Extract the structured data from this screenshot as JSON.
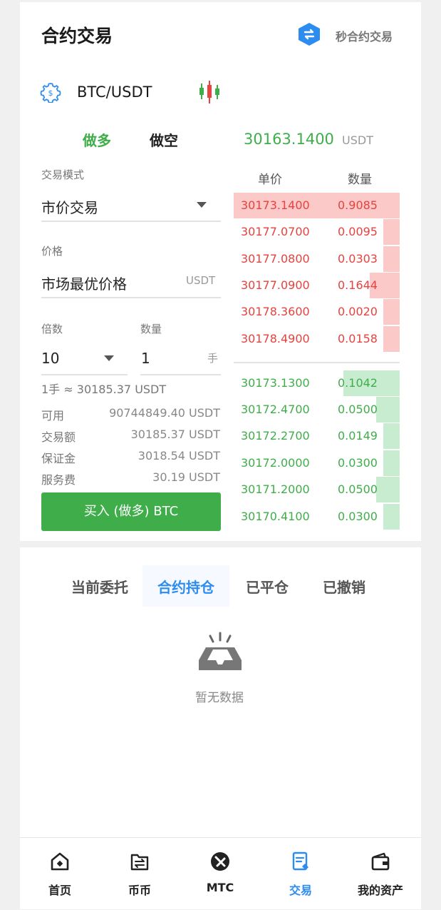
{
  "header": {
    "title": "合约交易",
    "swap_label": "秒合约交易"
  },
  "pair": {
    "symbol": "BTC/USDT"
  },
  "trade_tabs": {
    "long": "做多",
    "short": "做空"
  },
  "ticker": {
    "price": "30163.1400",
    "unit": "USDT"
  },
  "form": {
    "mode_label": "交易模式",
    "mode_value": "市价交易",
    "price_label": "价格",
    "price_value": "市场最优价格",
    "price_unit": "USDT",
    "leverage_label": "倍数",
    "leverage_value": "10",
    "quantity_label": "数量",
    "quantity_value": "1",
    "quantity_unit": "手",
    "lot_note": "1手 ≈ 30185.37 USDT"
  },
  "stats": [
    {
      "label": "可用",
      "value": "90744849.40 USDT"
    },
    {
      "label": "交易额",
      "value": "30185.37 USDT"
    },
    {
      "label": "保证金",
      "value": "3018.54 USDT"
    },
    {
      "label": "服务费",
      "value": "30.19 USDT"
    }
  ],
  "buy_button": "买入 (做多) BTC",
  "orderbook": {
    "price_header": "单价",
    "qty_header": "数量",
    "asks": [
      {
        "price": "30173.1400",
        "qty": "0.9085",
        "depth": 1.0
      },
      {
        "price": "30177.0700",
        "qty": "0.0095",
        "depth": 0.1
      },
      {
        "price": "30177.0800",
        "qty": "0.0303",
        "depth": 0.1
      },
      {
        "price": "30177.0900",
        "qty": "0.1644",
        "depth": 0.18
      },
      {
        "price": "30178.3600",
        "qty": "0.0020",
        "depth": 0.1
      },
      {
        "price": "30178.4900",
        "qty": "0.0158",
        "depth": 0.1
      }
    ],
    "bids": [
      {
        "price": "30173.1300",
        "qty": "0.1042",
        "depth": 0.34
      },
      {
        "price": "30172.4700",
        "qty": "0.0500",
        "depth": 0.14
      },
      {
        "price": "30172.2700",
        "qty": "0.0149",
        "depth": 0.1
      },
      {
        "price": "30172.0000",
        "qty": "0.0300",
        "depth": 0.1
      },
      {
        "price": "30171.2000",
        "qty": "0.0500",
        "depth": 0.14
      },
      {
        "price": "30170.4100",
        "qty": "0.0300",
        "depth": 0.1
      }
    ]
  },
  "order_tabs": [
    "当前委托",
    "合约持仓",
    "已平仓",
    "已撤销"
  ],
  "empty_text": "暂无数据",
  "nav": [
    {
      "label": "首页",
      "icon": "home-icon"
    },
    {
      "label": "币币",
      "icon": "wallet-exchange-icon"
    },
    {
      "label": "MTC",
      "icon": "mtc-icon"
    },
    {
      "label": "交易",
      "icon": "trade-icon"
    },
    {
      "label": "我的资产",
      "icon": "assets-icon"
    }
  ],
  "colors": {
    "green": "#3fae4a",
    "red": "#e8413e",
    "blue": "#2d8cf0"
  }
}
